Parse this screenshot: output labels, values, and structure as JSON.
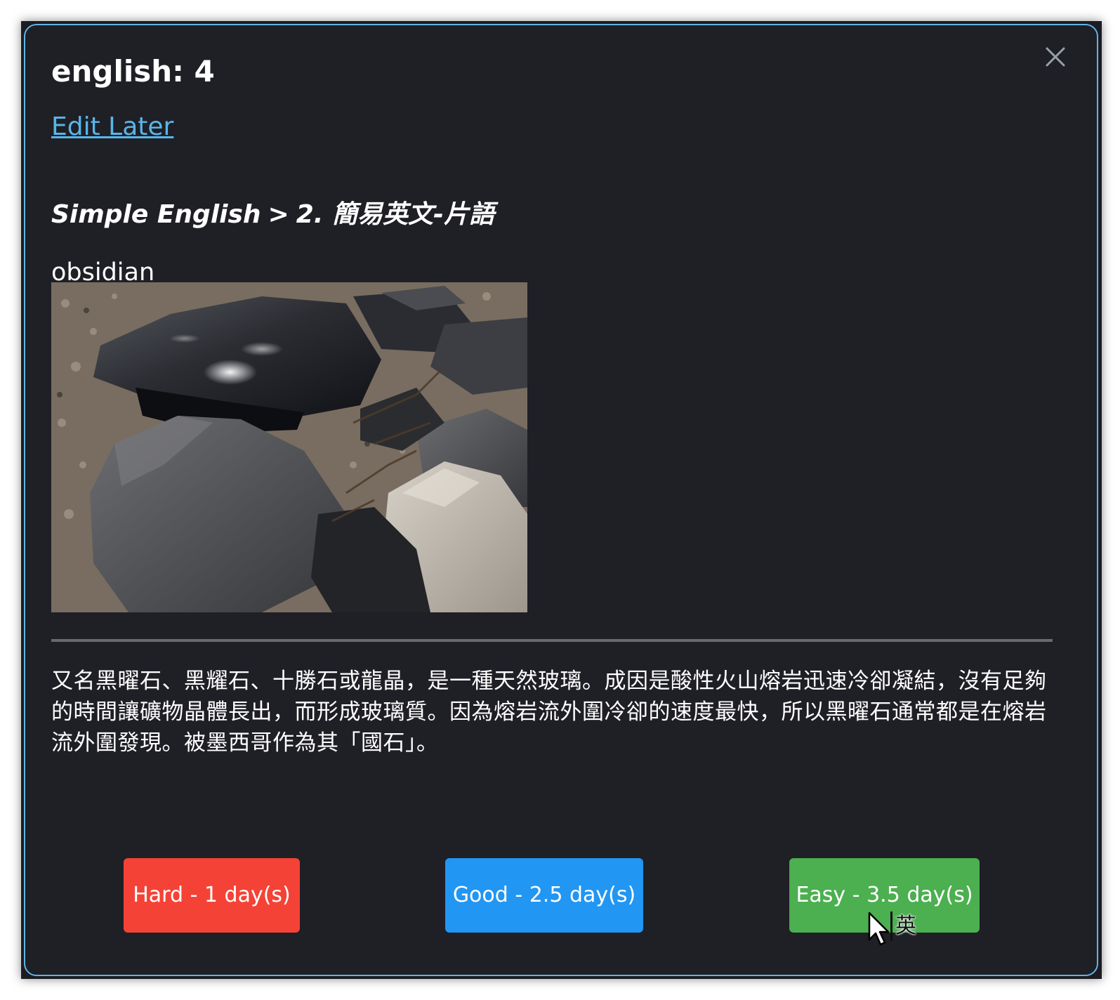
{
  "modal": {
    "title": "english: 4",
    "edit_link": "Edit Later",
    "breadcrumb": {
      "deck": "Simple English",
      "separator": ">",
      "section": "2. 簡易英文-片語"
    },
    "word": "obsidian",
    "image_alt": "obsidian rocks",
    "definition": "又名黑曜石、黑耀石、十勝石或龍晶，是一種天然玻璃。成因是酸性火山熔岩迅速冷卻凝結，沒有足夠的時間讓礦物晶體長出，而形成玻璃質。因為熔岩流外圍冷卻的速度最快，所以黑曜石通常都是在熔岩流外圍發現。被墨西哥作為其「國石」。",
    "close_icon": "close-icon"
  },
  "buttons": {
    "hard": "Hard - 1 day(s)",
    "good": "Good - 2.5 day(s)",
    "easy": "Easy - 3.5 day(s)"
  },
  "ime_indicator": "英",
  "colors": {
    "modal_bg": "#1f1f26",
    "modal_border": "#5fb4e6",
    "link": "#58b6e8",
    "hard": "#f44336",
    "good": "#2196f3",
    "easy": "#4caf50"
  }
}
